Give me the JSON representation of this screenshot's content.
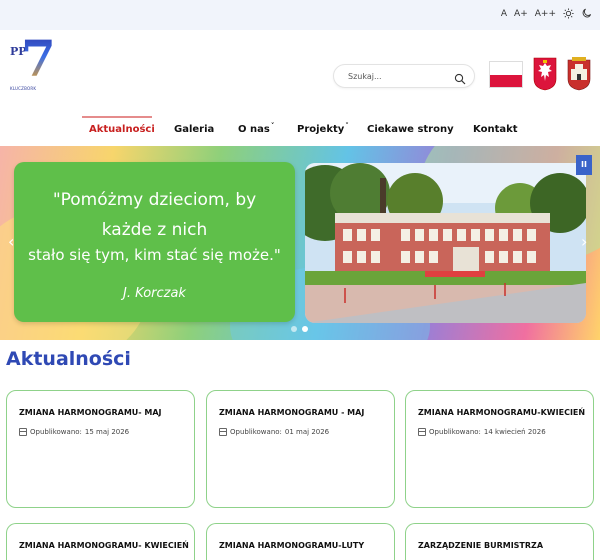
{
  "accessibility": {
    "font_small": "A",
    "font_medium": "A+",
    "font_large": "A++"
  },
  "logo": {
    "letters": "PP",
    "number": "7",
    "city": "KLUCZBORK"
  },
  "search": {
    "placeholder": "Szukaj..."
  },
  "nav": {
    "items": [
      {
        "label": "Aktualności",
        "active": true
      },
      {
        "label": "Galeria"
      },
      {
        "label": "O nas",
        "dropdown": true
      },
      {
        "label": "Projekty",
        "dropdown": true
      },
      {
        "label": "Ciekawe strony"
      },
      {
        "label": "Kontakt"
      }
    ],
    "caret": "˅"
  },
  "hero": {
    "quote_line1": "\"Pomóżmy dzieciom, by każde z nich",
    "quote_line2": "stało się tym, kim stać się może.\"",
    "author": "J. Korczak",
    "prev": "‹",
    "next": "›",
    "pause": "II"
  },
  "news": {
    "title": "Aktualności",
    "published_label": "Opublikowano:",
    "cards": [
      {
        "title": "ZMIANA HARMONOGRAMU- MAJ",
        "date": "15 maj 2026"
      },
      {
        "title": "ZMIANA HARMONOGRAMU - MAJ",
        "date": "01 maj 2026"
      },
      {
        "title": "ZMIANA HARMONOGRAMU-KWIECIEŃ",
        "date": "14 kwiecień 2026"
      },
      {
        "title": "ZMIANA HARMONOGRAMU- KWIECIEŃ",
        "date": ""
      },
      {
        "title": "ZMIANA HARMONOGRAMU-LUTY",
        "date": ""
      },
      {
        "title": "ZARZĄDZENIE BURMISTRZA",
        "date": ""
      }
    ]
  },
  "colors": {
    "accent_blue": "#2f49b4",
    "active_red": "#c8201f",
    "quote_green": "#5fbf4a",
    "card_border": "#8fd28a"
  }
}
